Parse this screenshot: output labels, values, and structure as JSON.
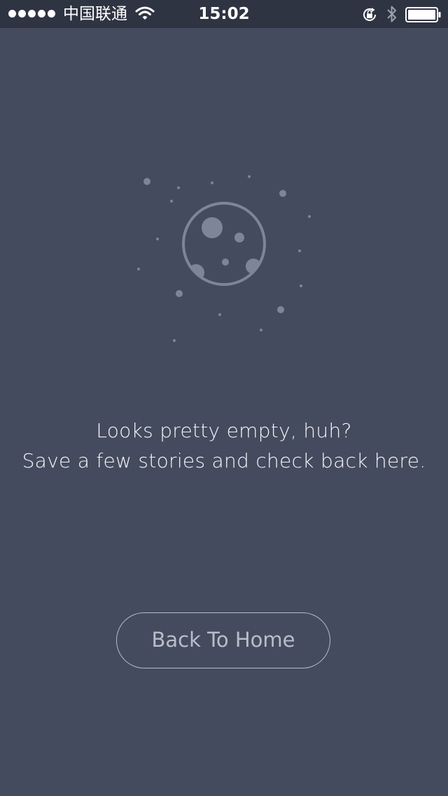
{
  "status_bar": {
    "carrier": "中国联通",
    "time": "15:02",
    "icons": [
      "signal-dots-icon",
      "wifi-icon",
      "rotation-lock-icon",
      "bluetooth-icon",
      "battery-icon"
    ]
  },
  "illustration": {
    "icon": "moon-icon",
    "decoration": "scattered-stars"
  },
  "empty_state": {
    "line1": "Looks pretty empty, huh?",
    "line2": "Save a few stories and check back here."
  },
  "actions": {
    "back_label": "Back To Home"
  },
  "colors": {
    "background": "#454b5e",
    "status_bar": "#2f3443",
    "illustration": "#7e8599",
    "text": "#f4f5f8",
    "button_border": "#b6bbc7"
  }
}
